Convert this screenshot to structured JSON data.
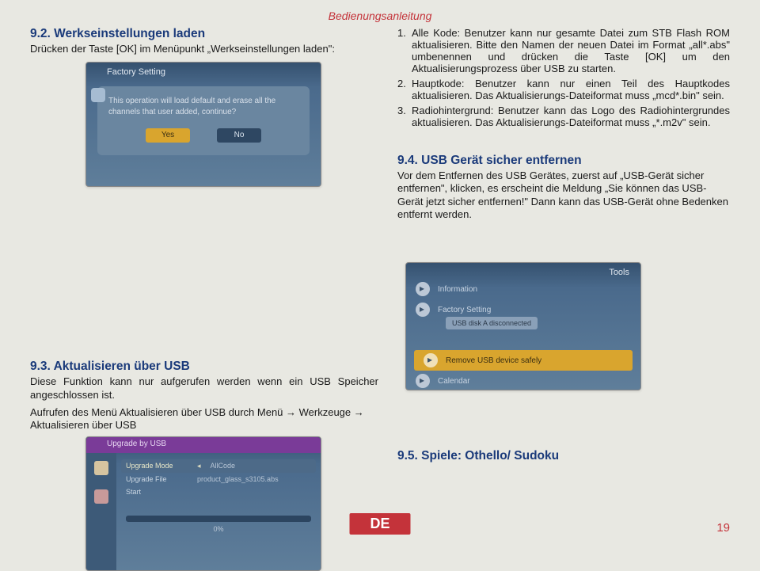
{
  "header_title": "Bedienungsanleitung",
  "sec92": {
    "heading": "9.2. Werkseinstellungen laden",
    "text": "Drücken der Taste [OK] im Menüpunkt „Werkseinstellungen laden\":"
  },
  "list": {
    "item1_num": "1.",
    "item1_text": "Alle Kode: Benutzer kann nur gesamte Datei zum STB Flash ROM aktualisieren. Bitte den Namen der neuen Datei im Format „all*.abs\" umbenennen und drücken die Taste [OK] um den Aktualisierungsprozess über USB zu starten.",
    "item2_num": "2.",
    "item2_text": "Hauptkode: Benutzer kann nur einen Teil des Hauptkodes aktualisieren. Das Aktualisierungs-Dateiformat muss „mcd*.bin\" sein.",
    "item3_num": "3.",
    "item3_text": "Radiohintergrund: Benutzer kann das Logo des Radiohintergrundes aktualisieren. Das Aktualisierungs-Dateiformat muss „*.m2v\" sein."
  },
  "sec94": {
    "heading": "9.4. USB Gerät sicher entfernen",
    "text": "Vor dem Entfernen des USB Gerätes, zuerst auf „USB-Gerät sicher entfernen\", klicken, es erscheint die Meldung „Sie können das USB-Gerät jetzt sicher entfernen!\" Dann kann das USB-Gerät ohne Bedenken entfernt werden."
  },
  "sec93": {
    "heading": "9.3. Aktualisieren über USB",
    "text1": "Diese Funktion kann nur aufgerufen werden wenn ein USB Speicher angeschlossen ist.",
    "text2": "Aufrufen des Menü Aktualisieren über USB durch Menü → Werkzeuge → Aktualisieren über USB"
  },
  "sec95": {
    "heading": "9.5. Spiele: Othello/ Sudoku"
  },
  "screenshot_setup": {
    "title": "Factory Setting",
    "dialog1": "This operation will load default and erase all the channels that user added, continue?",
    "yes": "Yes",
    "no": "No"
  },
  "screenshot_upgrade": {
    "title": "Upgrade by USB",
    "row1_label": "Upgrade Mode",
    "row1_value": "AllCode",
    "row2_label": "Upgrade File",
    "row2_value": "product_glass_s3105.abs",
    "row3_label": "Start",
    "progress": "0%"
  },
  "screenshot_tools": {
    "title": "Tools",
    "items": {
      "info": "Information",
      "factory": "Factory Setting",
      "tooltip": "USB disk A disconnected",
      "remove": "Remove USB device safely",
      "calendar": "Calendar"
    }
  },
  "footer": {
    "lang": "DE",
    "page": "19"
  }
}
